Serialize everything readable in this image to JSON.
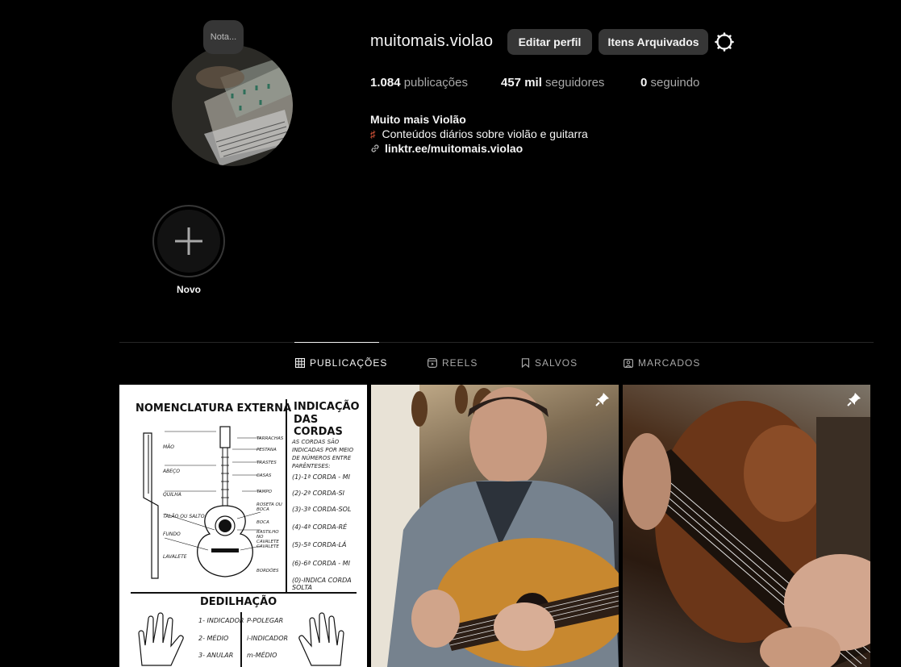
{
  "profile": {
    "note": "Nota...",
    "username": "muitomais.violao",
    "edit_button": "Editar perfil",
    "archive_button": "Itens Arquivados",
    "stats": {
      "posts_value": "1.084",
      "posts_label": "publicações",
      "followers_value": "457 mil",
      "followers_label": "seguidores",
      "following_value": "0",
      "following_label": "seguindo"
    },
    "full_name": "Muito mais Violão",
    "bio": "Conteúdos diários sobre violão e guitarra",
    "link": "linktr.ee/muitomais.violao"
  },
  "highlights": {
    "new_label": "Novo"
  },
  "tabs": [
    {
      "label": "PUBLICAÇÕES",
      "icon": "grid-icon",
      "active": true
    },
    {
      "label": "REELS",
      "icon": "reels-icon",
      "active": false
    },
    {
      "label": "SALVOS",
      "icon": "bookmark-icon",
      "active": false
    },
    {
      "label": "MARCADOS",
      "icon": "tag-icon",
      "active": false
    }
  ],
  "posts": {
    "post1": {
      "title_left": "NOMENCLATURA EXTERNA",
      "title_right_1": "INDICAÇÃO",
      "title_right_2": "DAS CORDAS",
      "intro": "AS CORDAS SÃO INDICADAS POR MEIO DE NÚMEROS ENTRE PARÊNTESES:",
      "strings": [
        "(1)-1ª CORDA - MI",
        "(2)-2ª CORDA-SI",
        "(3)-3ª CORDA-SOL",
        "(4)-4ª CORDA-RÉ",
        "(5)-5ª CORDA-LÁ",
        "(6)-6ª CORDA - MI",
        "(0)-INDICA CORDA SOLTA"
      ],
      "parts_left": [
        "MÃO",
        "ABEÇO",
        "QUILHA",
        "TALÃO OU SALTO",
        "FUNDO",
        "LAVALETE"
      ],
      "parts_right": [
        "TARRACHAS",
        "PESTANA",
        "TRASTES",
        "CASAS",
        "TAMPO",
        "ROSETA OU BOCA",
        "BOCA",
        "RASTILHO NO CAVALETE",
        "CAVALETE",
        "BORDÕES"
      ],
      "section": "DEDILHAÇÃO",
      "fingers_left": [
        "1- INDICADOR",
        "2- MÉDIO",
        "3- ANULAR"
      ],
      "fingers_right": [
        "P-POLEGAR",
        "i-INDICADOR",
        "m-MÉDIO"
      ]
    }
  },
  "colors": {
    "background": "#000000",
    "button": "#363636",
    "text": "#f5f5f5",
    "muted": "#a8a8a8"
  }
}
